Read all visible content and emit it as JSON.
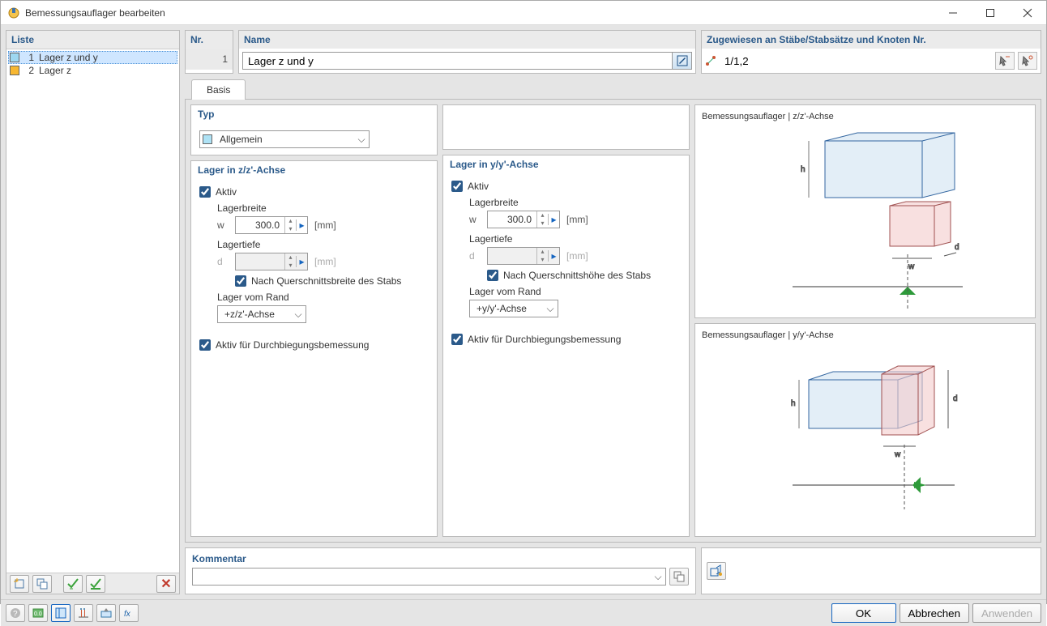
{
  "window": {
    "title": "Bemessungsauflager bearbeiten"
  },
  "leftpanel": {
    "header": "Liste",
    "items": [
      {
        "num": "1",
        "label": "Lager z und y",
        "color": "#9ed7f0",
        "selected": true
      },
      {
        "num": "2",
        "label": "Lager z",
        "color": "#f7b731",
        "selected": false
      }
    ]
  },
  "header": {
    "nr_label": "Nr.",
    "nr_value": "1",
    "name_label": "Name",
    "name_value": "Lager z und y",
    "assigned_label": "Zugewiesen an Stäbe/Stabsätze und Knoten Nr.",
    "assigned_value": "1/1,2"
  },
  "tabs": {
    "basis": "Basis"
  },
  "typ": {
    "header": "Typ",
    "value": "Allgemein"
  },
  "axis_z": {
    "header": "Lager in z/z'-Achse",
    "active_label": "Aktiv",
    "width_label": "Lagerbreite",
    "width_var": "w",
    "width_value": "300.0",
    "unit": "[mm]",
    "depth_label": "Lagertiefe",
    "depth_var": "d",
    "depth_value": "",
    "depth_check_label": "Nach Querschnittsbreite des Stabs",
    "edge_label": "Lager vom Rand",
    "edge_value": "+z/z'-Achse",
    "deflection_label": "Aktiv für Durchbiegungsbemessung"
  },
  "axis_y": {
    "header": "Lager in y/y'-Achse",
    "active_label": "Aktiv",
    "width_label": "Lagerbreite",
    "width_var": "w",
    "width_value": "300.0",
    "unit": "[mm]",
    "depth_label": "Lagertiefe",
    "depth_var": "d",
    "depth_value": "",
    "depth_check_label": "Nach Querschnittshöhe des Stabs",
    "edge_label": "Lager vom Rand",
    "edge_value": "+y/y'-Achse",
    "deflection_label": "Aktiv für Durchbiegungsbemessung"
  },
  "diagram": {
    "zz_title": "Bemessungsauflager | z/z'-Achse",
    "yy_title": "Bemessungsauflager | y/y'-Achse"
  },
  "comment": {
    "header": "Kommentar",
    "value": ""
  },
  "buttons": {
    "ok": "OK",
    "cancel": "Abbrechen",
    "apply": "Anwenden"
  }
}
